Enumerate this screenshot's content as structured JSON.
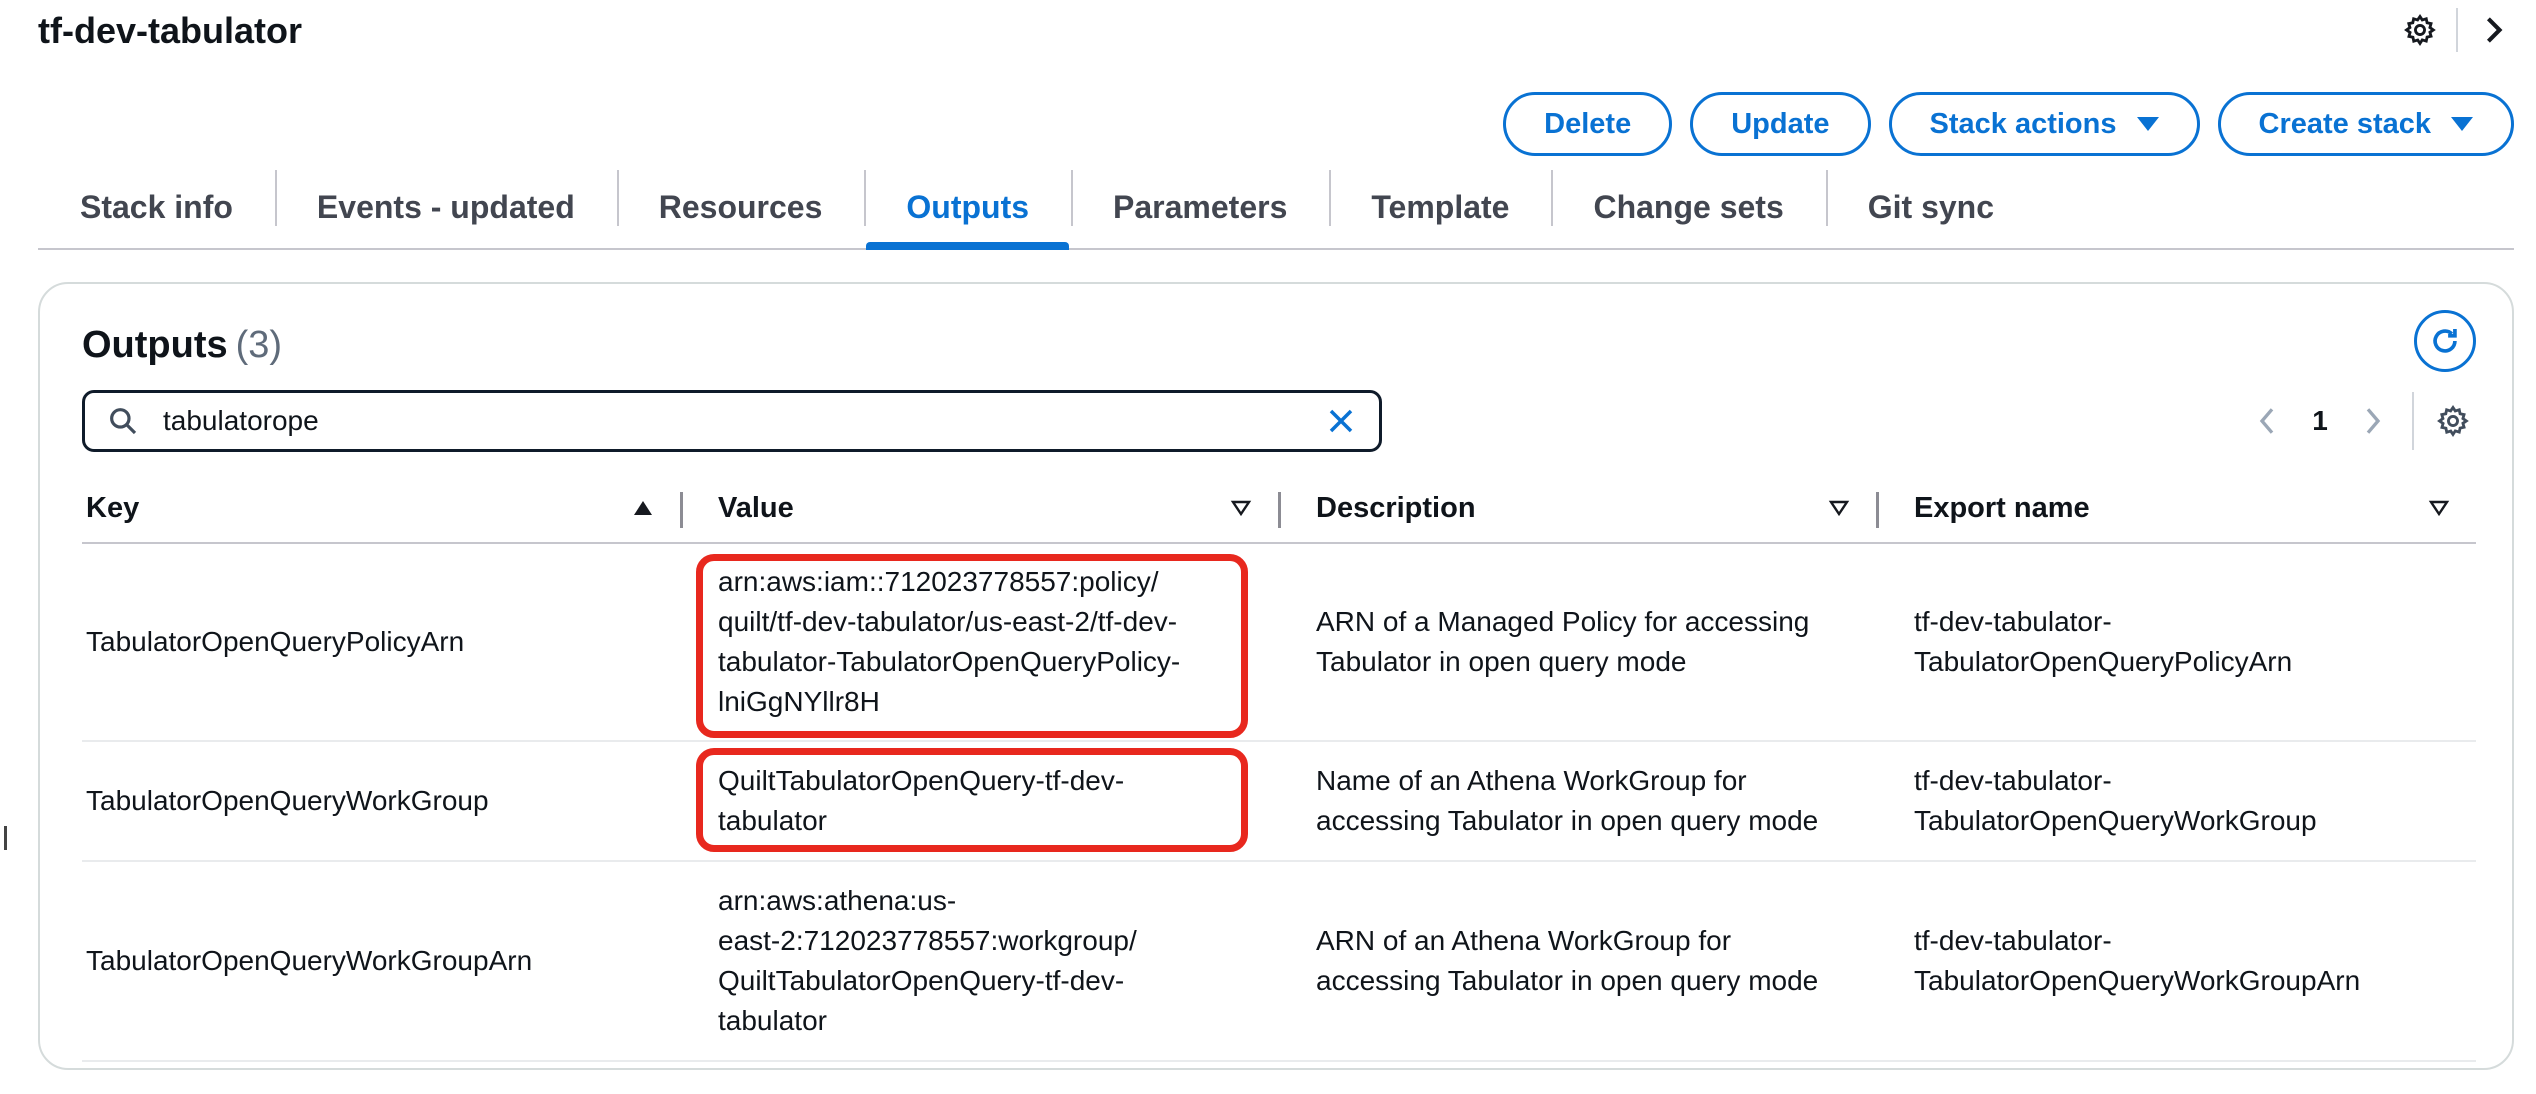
{
  "header": {
    "stack_name": "tf-dev-tabulator",
    "icons": {
      "settings": "gear-icon",
      "collapse": "chevron-right-icon"
    }
  },
  "actions": [
    {
      "label": "Delete",
      "dropdown": false
    },
    {
      "label": "Update",
      "dropdown": false
    },
    {
      "label": "Stack actions",
      "dropdown": true
    },
    {
      "label": "Create stack",
      "dropdown": true
    }
  ],
  "tabs": [
    {
      "label": "Stack info",
      "active": false
    },
    {
      "label": "Events - updated",
      "active": false
    },
    {
      "label": "Resources",
      "active": false
    },
    {
      "label": "Outputs",
      "active": true
    },
    {
      "label": "Parameters",
      "active": false
    },
    {
      "label": "Template",
      "active": false
    },
    {
      "label": "Change sets",
      "active": false
    },
    {
      "label": "Git sync",
      "active": false
    }
  ],
  "outputs": {
    "title": "Outputs",
    "count": "(3)",
    "search_value": "tabulatorope",
    "page": "1",
    "columns": [
      {
        "label": "Key",
        "sort": "ascending"
      },
      {
        "label": "Value",
        "sort": "none"
      },
      {
        "label": "Description",
        "sort": "none"
      },
      {
        "label": "Export name",
        "sort": "none"
      }
    ],
    "rows": [
      {
        "key": "TabulatorOpenQueryPolicyArn",
        "value": "arn:aws:iam::712023778557:policy/\nquilt/tf-dev-tabulator/us-east-2/tf-dev-\ntabulator-TabulatorOpenQueryPolicy-\nlniGgNYllr8H",
        "description": "ARN of a Managed Policy for accessing\nTabulator in open query mode",
        "export_name": "tf-dev-tabulator-\nTabulatorOpenQueryPolicyArn",
        "highlighted": true
      },
      {
        "key": "TabulatorOpenQueryWorkGroup",
        "value": "QuiltTabulatorOpenQuery-tf-dev-\ntabulator",
        "description": "Name of an Athena WorkGroup for\naccessing Tabulator in open query mode",
        "export_name": "tf-dev-tabulator-\nTabulatorOpenQueryWorkGroup",
        "highlighted": true
      },
      {
        "key": "TabulatorOpenQueryWorkGroupArn",
        "value": "arn:aws:athena:us-\neast-2:712023778557:workgroup/\nQuiltTabulatorOpenQuery-tf-dev-\ntabulator",
        "description": "ARN of an Athena WorkGroup for\naccessing Tabulator in open query mode",
        "export_name": "tf-dev-tabulator-\nTabulatorOpenQueryWorkGroupArn",
        "highlighted": false
      }
    ]
  },
  "colors": {
    "accent": "#0972d3",
    "highlight": "#e8281e",
    "text": "#0f141a"
  }
}
